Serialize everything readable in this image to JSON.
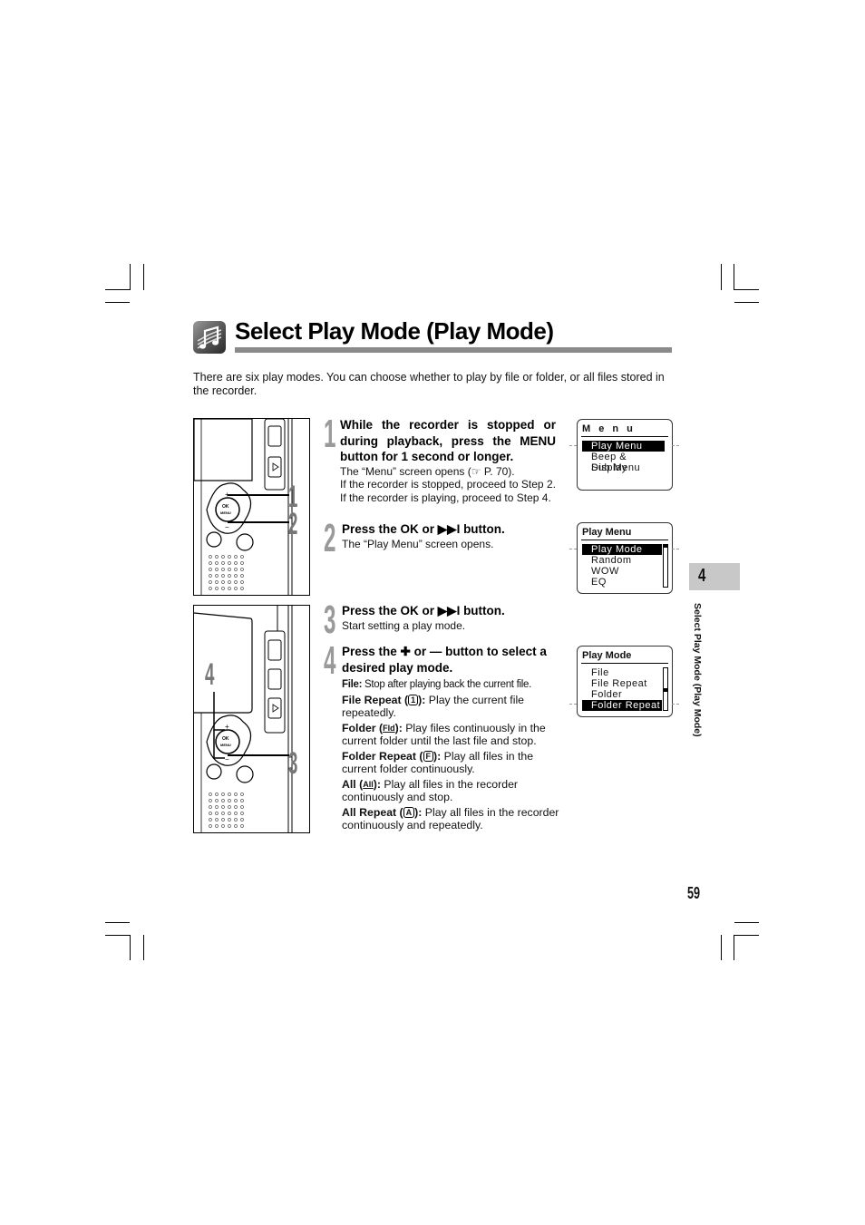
{
  "header": {
    "title": "Select Play Mode (Play Mode)",
    "icon": "music-notes-icon",
    "intro": "There are six play modes. You can choose whether to play by file or folder, or all files stored in the recorder."
  },
  "illustrations": [
    {
      "callouts": [
        "1",
        "2"
      ]
    },
    {
      "callouts": [
        "4",
        "3"
      ]
    }
  ],
  "steps": [
    {
      "number": "1",
      "heading_pre": "While the recorder is stopped or during playback, press the ",
      "heading_key": "MENU",
      "heading_post": " button for 1 second or longer.",
      "body": [
        "The “Menu” screen opens (☞ P. 70).",
        "If the recorder is stopped, proceed to Step 2. If the recorder is playing, proceed to Step 4."
      ]
    },
    {
      "number": "2",
      "heading_pre": "Press the ",
      "heading_key": "OK",
      "heading_post": " or ▶▶I button.",
      "body": [
        "The “Play Menu” screen opens."
      ]
    },
    {
      "number": "3",
      "heading_pre": "Press the ",
      "heading_key": "OK",
      "heading_post": " or ▶▶I button.",
      "body": [
        "Start setting a play mode."
      ]
    },
    {
      "number": "4",
      "heading": "Press the ✚ or — button to select a desired play mode.",
      "modes": [
        {
          "label": "File:",
          "icon": "",
          "desc": " Stop after playing back the current file."
        },
        {
          "label": "File Repeat (",
          "icon": "1",
          "icon_style": "boxed",
          "label_end": "):",
          "desc": " Play the current file repeatedly."
        },
        {
          "label": "Folder (",
          "icon": "Fld",
          "icon_style": "arrow",
          "label_end": "):",
          "desc": " Play files continuously in the current folder until the last file and stop."
        },
        {
          "label": "Folder Repeat (",
          "icon": "F",
          "icon_style": "boxed",
          "label_end": "):",
          "desc": " Play all files in the current folder continuously."
        },
        {
          "label": "All (",
          "icon": "All",
          "icon_style": "arrow",
          "label_end": "):",
          "desc": " Play all files in the recorder continuously and stop."
        },
        {
          "label": "All Repeat (",
          "icon": "A",
          "icon_style": "boxed",
          "label_end": "):",
          "desc": " Play all files in the recorder continuously and repeatedly."
        }
      ]
    }
  ],
  "screens": [
    {
      "title": "M e n u",
      "items": [
        "Play Menu",
        "Beep & Display",
        "Sub Menu"
      ],
      "selected": 0,
      "scrollbar": false
    },
    {
      "title": "Play Menu",
      "items": [
        "Play Mode",
        "Random",
        "WOW",
        "EQ"
      ],
      "selected": 0,
      "scrollbar": true
    },
    {
      "title": "Play Mode",
      "items": [
        "File",
        "File Repeat",
        "Folder",
        "Folder Repeat"
      ],
      "selected": 3,
      "scrollbar": true
    }
  ],
  "side_tab": {
    "chapter": "4",
    "label": "Select Play Mode (Play Mode)"
  },
  "footer": {
    "page_number": "59"
  }
}
